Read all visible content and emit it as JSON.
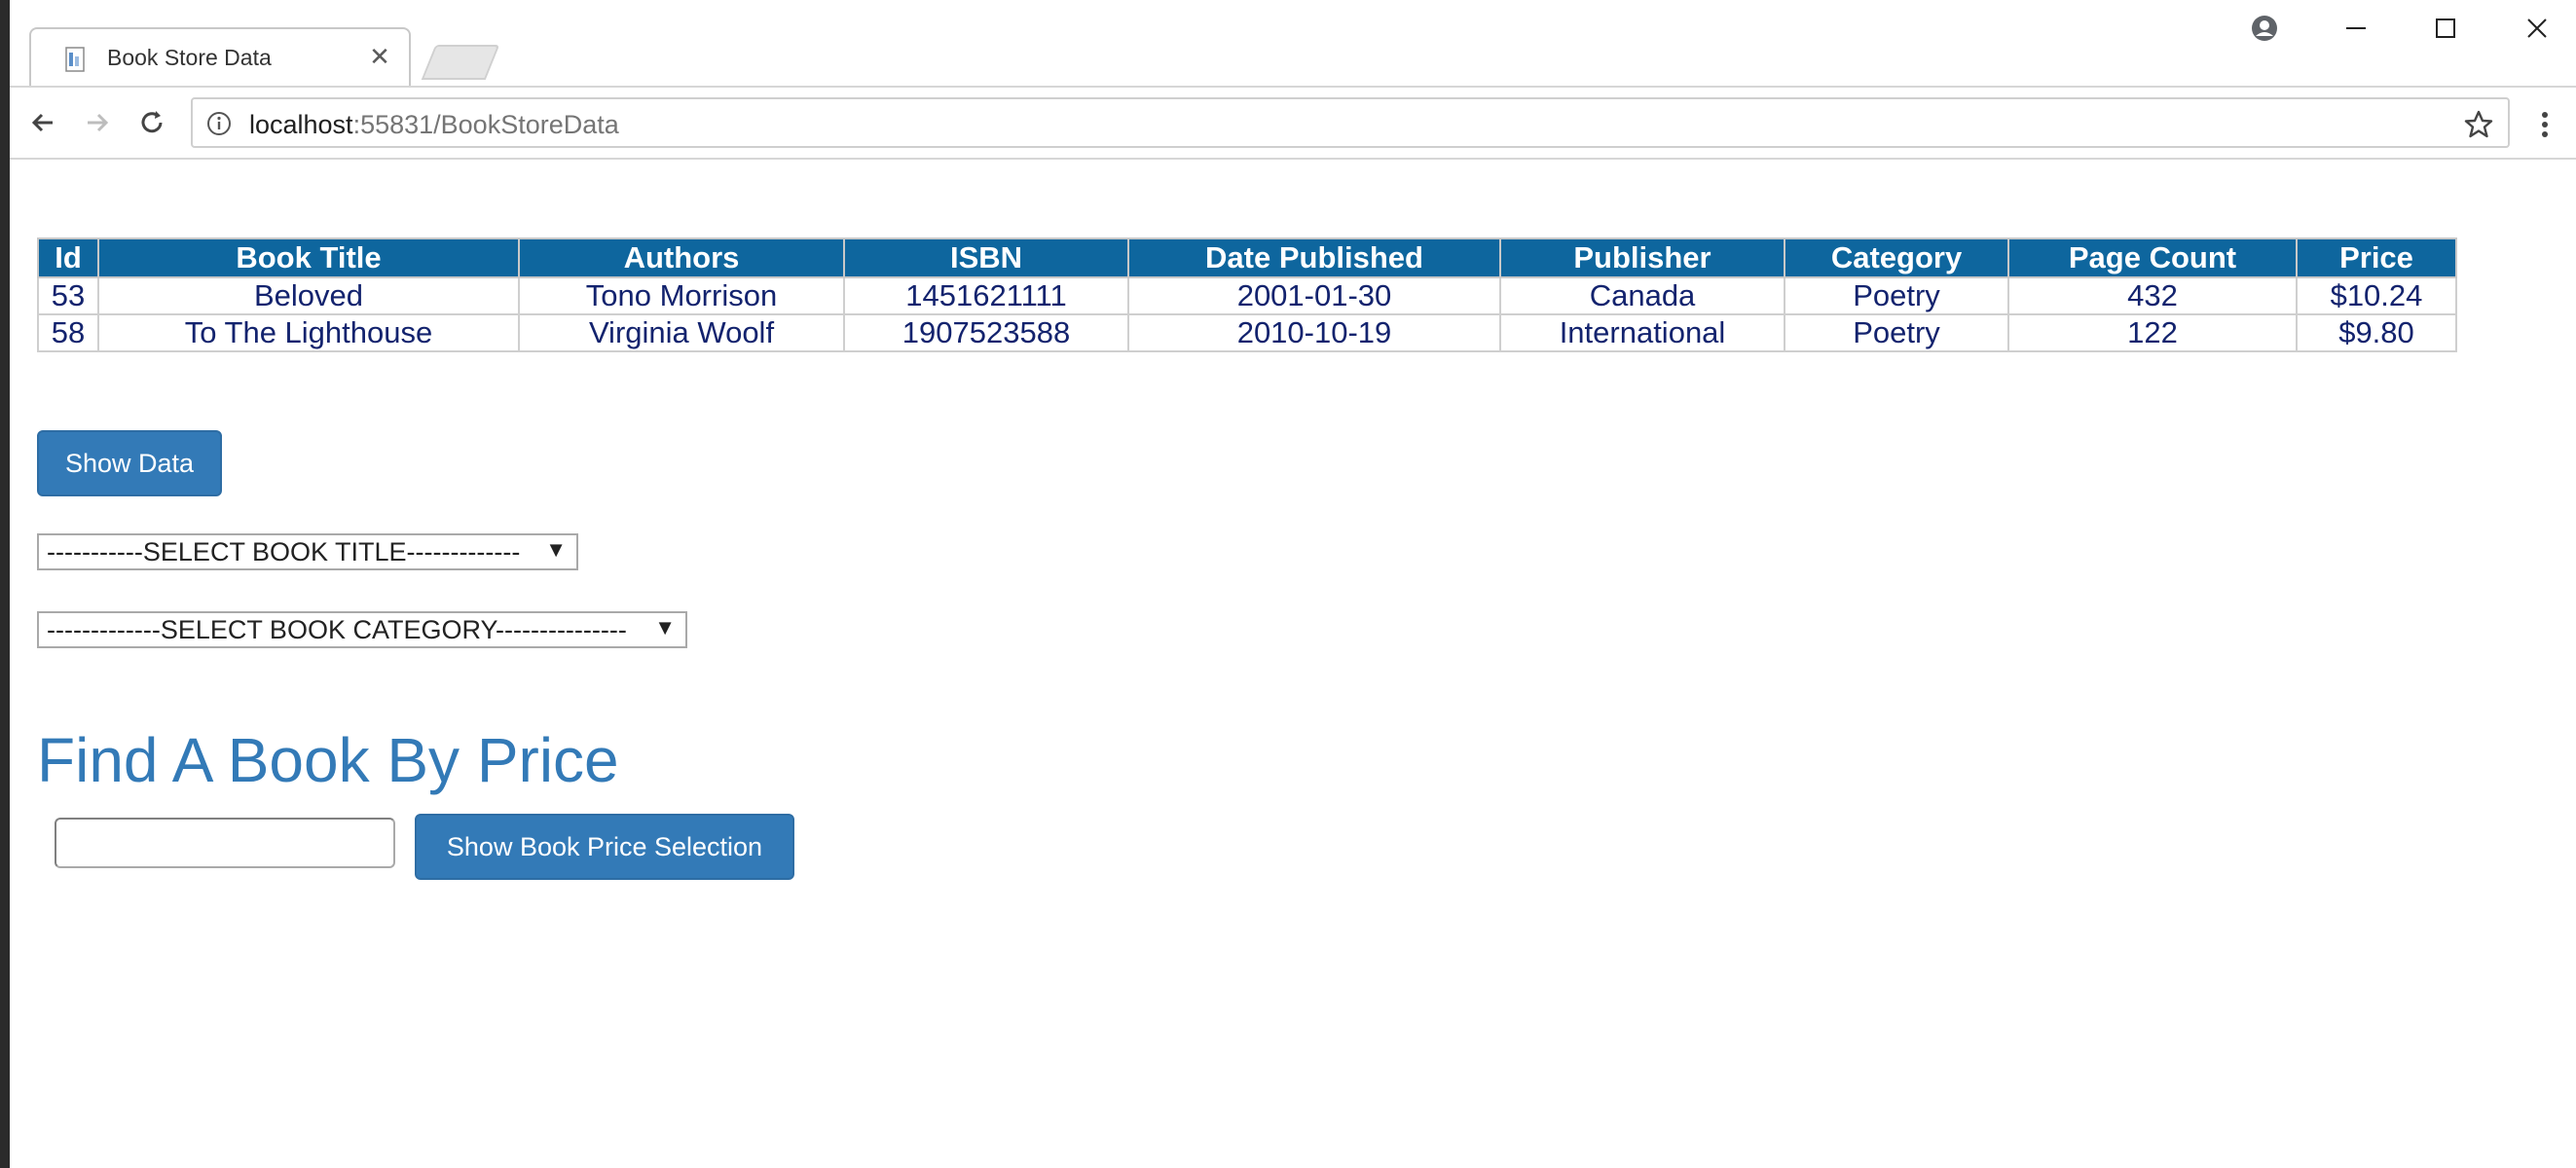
{
  "browser": {
    "tab_title": "Book Store Data",
    "url_host": "localhost",
    "url_rest": ":55831/BookStoreData"
  },
  "table": {
    "headers": [
      "Id",
      "Book Title",
      "Authors",
      "ISBN",
      "Date Published",
      "Publisher",
      "Category",
      "Page Count",
      "Price"
    ],
    "rows": [
      [
        "53",
        "Beloved",
        "Tono Morrison",
        "1451621111",
        "2001-01-30",
        "Canada",
        "Poetry",
        "432",
        "$10.24"
      ],
      [
        "58",
        "To The Lighthouse",
        "Virginia Woolf",
        "1907523588",
        "2010-10-19",
        "International",
        "Poetry",
        "122",
        "$9.80"
      ]
    ]
  },
  "controls": {
    "show_data_label": "Show Data",
    "title_select_value": "-----------SELECT BOOK TITLE-------------",
    "category_select_value": "-------------SELECT BOOK CATEGORY---------------",
    "price_heading": "Find A Book By Price",
    "price_input_value": "",
    "show_price_label": "Show Book Price Selection"
  },
  "colors": {
    "table_header_bg": "#0e669e",
    "table_text": "#13236e",
    "button_bg": "#337ab7",
    "heading": "#337ab7"
  }
}
